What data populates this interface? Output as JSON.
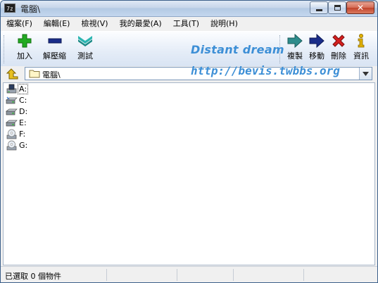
{
  "window": {
    "title": "電腦\\",
    "app_icon_text": "7z"
  },
  "menu": [
    {
      "label": "檔案(F)"
    },
    {
      "label": "編輯(E)"
    },
    {
      "label": "檢視(V)"
    },
    {
      "label": "我的最愛(A)"
    },
    {
      "label": "工具(T)"
    },
    {
      "label": "說明(H)"
    }
  ],
  "toolbar": {
    "add_label": "加入",
    "extract_label": "解壓縮",
    "test_label": "測試",
    "copy_label": "複製",
    "move_label": "移動",
    "delete_label": "刪除",
    "info_label": "資訊",
    "brand_text": "Distant dream",
    "url_text": "http://bevis.twbbs.org"
  },
  "address": {
    "path": "電腦\\"
  },
  "drives": [
    {
      "name": "A:",
      "icon": "floppy-drive-icon",
      "selected": true
    },
    {
      "name": "C:",
      "icon": "hard-drive-icon",
      "selected": false
    },
    {
      "name": "D:",
      "icon": "hard-drive-icon",
      "selected": false
    },
    {
      "name": "E:",
      "icon": "hard-drive-icon",
      "selected": false
    },
    {
      "name": "F:",
      "icon": "cd-drive-icon",
      "selected": false
    },
    {
      "name": "G:",
      "icon": "cd-drive-icon",
      "selected": false
    }
  ],
  "status": {
    "text": "已選取 0 個物件"
  },
  "colors": {
    "brand": "#3d8fd6",
    "add": "#22aa22",
    "delete": "#d42020",
    "accent": "#1a2d8a"
  }
}
